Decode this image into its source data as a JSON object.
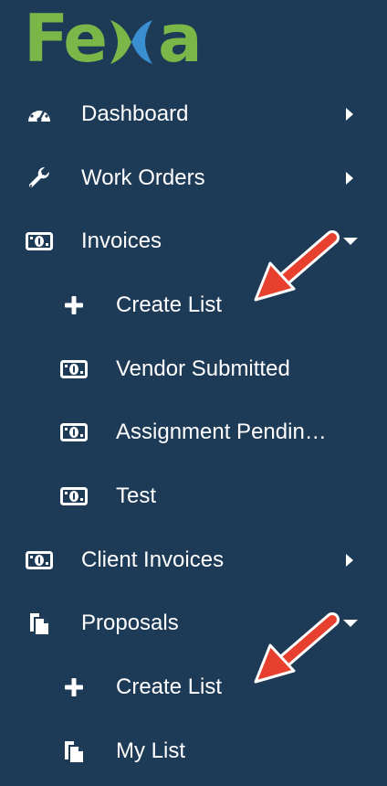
{
  "app": {
    "logo_text_left": "Fe",
    "logo_text_right": "a",
    "brand_green": "#7ab648",
    "brand_blue": "#3a8fd0",
    "bg": "#1d3a57"
  },
  "sidebar": {
    "items": [
      {
        "label": "Dashboard",
        "icon": "dashboard-gauge-icon",
        "caret": "right"
      },
      {
        "label": "Work Orders",
        "icon": "wrench-icon",
        "caret": "right"
      },
      {
        "label": "Invoices",
        "icon": "money-bill-icon",
        "caret": "down"
      },
      {
        "label": "Create List",
        "icon": "plus-icon",
        "sub": true
      },
      {
        "label": "Vendor Submitted",
        "icon": "money-bill-icon",
        "sub": true
      },
      {
        "label": "Assignment Pendin…",
        "icon": "money-bill-icon",
        "sub": true
      },
      {
        "label": "Test",
        "icon": "money-bill-icon",
        "sub": true
      },
      {
        "label": "Client Invoices",
        "icon": "money-bill-icon",
        "caret": "right"
      },
      {
        "label": "Proposals",
        "icon": "copy-documents-icon",
        "caret": "down"
      },
      {
        "label": "Create List",
        "icon": "plus-icon",
        "sub": true
      },
      {
        "label": "My List",
        "icon": "copy-documents-icon",
        "sub": true
      }
    ]
  },
  "annotations": {
    "arrow_color": "#e8402f"
  }
}
